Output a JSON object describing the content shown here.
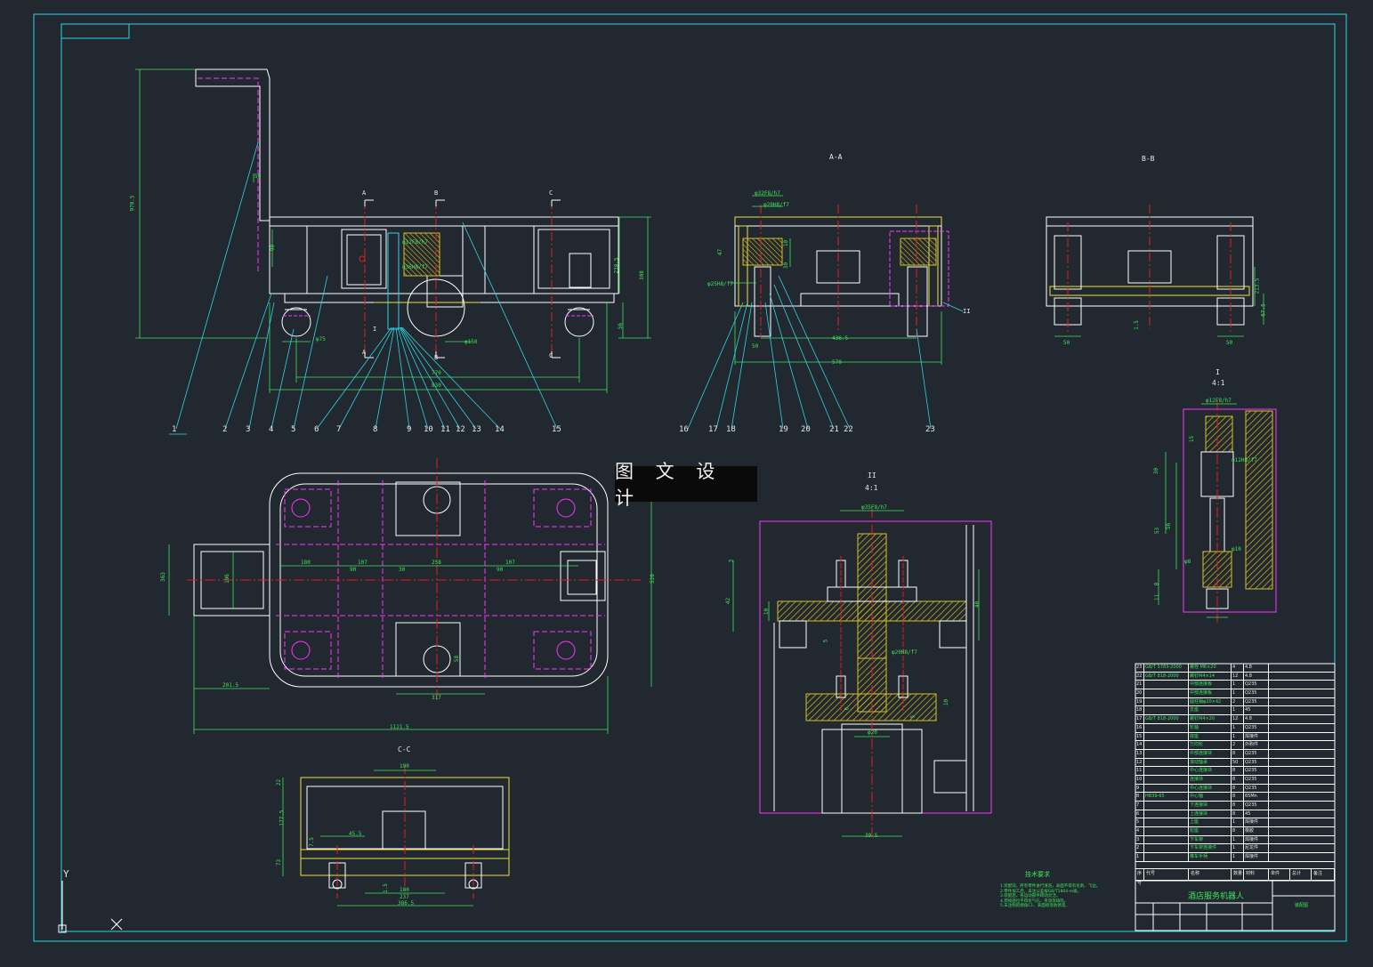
{
  "watermark": "图 文 设 计",
  "view_titles": {
    "section_aa": "A-A",
    "section_bb": "B-B",
    "section_cc": "C-C",
    "detail_i_label": "I",
    "detail_i_scale": "4:1",
    "detail_ii_label": "II",
    "detail_ii_scale": "4:1"
  },
  "section_markers": [
    "A",
    "B",
    "C",
    "A",
    "B",
    "C",
    "I",
    "II"
  ],
  "callouts": [
    "1",
    "2",
    "3",
    "4",
    "5",
    "6",
    "7",
    "8",
    "9",
    "10",
    "11",
    "12",
    "13",
    "14",
    "15",
    "16",
    "17",
    "18",
    "19",
    "20",
    "21",
    "22",
    "23"
  ],
  "dimensions": {
    "front": [
      "970.5",
      "50",
      "90",
      "238.5",
      "308",
      "56",
      "φ75",
      "φ12F8/h7",
      "φ36H8/f7",
      "φ150",
      "770",
      "830"
    ],
    "section_aa": [
      "φ32F8/h7",
      "φ20H8/f7",
      "47",
      "10",
      "φ25H8/f7",
      "30",
      "50",
      "436.5",
      "570"
    ],
    "section_bb": [
      "213.5",
      "67.5",
      "1.5",
      "50",
      "50"
    ],
    "plan": [
      "180",
      "107",
      "90",
      "30",
      "258",
      "107",
      "90",
      "363",
      "196",
      "520",
      "58",
      "317",
      "201.5",
      "1121.5"
    ],
    "section_cc": [
      "190",
      "22",
      "177.5",
      "45.5",
      "73",
      "7.5",
      "1.5",
      "180",
      "237",
      "386.5"
    ],
    "detail_ii": [
      "φ35F8/h7",
      "42",
      "3",
      "10",
      "5",
      "40",
      "φ20H8/f7",
      "5",
      "10",
      "6",
      "φ20",
      "39.5"
    ],
    "detail_i": [
      "φ12F8/h7",
      "15",
      "φ12H8/f7",
      "30",
      "53",
      "56",
      "φ8",
      "φ10",
      "8",
      "11"
    ]
  },
  "bom": {
    "rows": [
      {
        "no": "23",
        "code": "GB/T 5783-2000",
        "name": "螺栓 M6×20",
        "qty": "4",
        "mat": "4.8"
      },
      {
        "no": "22",
        "code": "GB/T 818-2000",
        "name": "螺钉M4×14",
        "qty": "12",
        "mat": "4.8"
      },
      {
        "no": "21",
        "code": "",
        "name": "中部连接板",
        "qty": "1",
        "mat": "Q235"
      },
      {
        "no": "20",
        "code": "",
        "name": "中部连接板",
        "qty": "1",
        "mat": "Q235"
      },
      {
        "no": "19",
        "code": "",
        "name": "圆柱销φ20×42",
        "qty": "2",
        "mat": "Q235"
      },
      {
        "no": "18",
        "code": "",
        "name": "支座",
        "qty": "1",
        "mat": "45"
      },
      {
        "no": "17",
        "code": "GB/T 818-2000",
        "name": "螺钉M4×20",
        "qty": "12",
        "mat": "4.8"
      },
      {
        "no": "16",
        "code": "",
        "name": "轮轴",
        "qty": "1",
        "mat": "Q235"
      },
      {
        "no": "15",
        "code": "",
        "name": "底座",
        "qty": "1",
        "mat": "焊接件"
      },
      {
        "no": "14",
        "code": "",
        "name": "万向轮",
        "qty": "2",
        "mat": "外购件"
      },
      {
        "no": "13",
        "code": "",
        "name": "中部连接块",
        "qty": "8",
        "mat": "Q235"
      },
      {
        "no": "12",
        "code": "",
        "name": "滚动轴承",
        "qty": "50",
        "mat": "Q235"
      },
      {
        "no": "11",
        "code": "",
        "name": "中心连接块",
        "qty": "8",
        "mat": "Q235"
      },
      {
        "no": "10",
        "code": "",
        "name": "连接块",
        "qty": "8",
        "mat": "Q235"
      },
      {
        "no": "9",
        "code": "",
        "name": "中心连接块",
        "qty": "8",
        "mat": "Q235"
      },
      {
        "no": "8",
        "code": "HB39-65",
        "name": "中心轴",
        "qty": "8",
        "mat": "65Mn"
      },
      {
        "no": "7",
        "code": "",
        "name": "下连接块",
        "qty": "8",
        "mat": "Q235"
      },
      {
        "no": "6",
        "code": "",
        "name": "上连接块",
        "qty": "8",
        "mat": "45"
      },
      {
        "no": "5",
        "code": "",
        "name": "上座",
        "qty": "1",
        "mat": "焊接件"
      },
      {
        "no": "4",
        "code": "",
        "name": "轮座",
        "qty": "8",
        "mat": "橡胶"
      },
      {
        "no": "3",
        "code": "",
        "name": "下车架",
        "qty": "1",
        "mat": "焊接件"
      },
      {
        "no": "2",
        "code": "",
        "name": "下车架连接件",
        "qty": "1",
        "mat": "尼龙件"
      },
      {
        "no": "1",
        "code": "",
        "name": "推车手柄",
        "qty": "1",
        "mat": "焊接件"
      }
    ],
    "header": [
      "序号",
      "代号",
      "名称",
      "数量",
      "材料",
      "单件",
      "总计",
      "备注"
    ]
  },
  "title_block": {
    "name": "酒店服务机器人",
    "code": "装配图"
  },
  "tech_requirements": {
    "title": "技术要求",
    "lines": [
      "1.装配前，所有零件进行清洗，表面不得有毛刺、飞边。",
      "2.零件加工后，未注公差按GB/T1804-m级。",
      "3.装配后，各运动部件转动灵活。",
      "4.焊接部位不得有气孔、夹渣等缺陷。",
      "5.未注明的倒角C1，表面喷涂防锈漆。"
    ]
  },
  "colors": {
    "background": "#212830",
    "frame": "#2fd3e3",
    "part_white": "#ffffff",
    "centerline_red": "#e02020",
    "hidden_magenta": "#ff33ff",
    "dimension_green": "#3fe35a",
    "highlight_yellow": "#f0e040",
    "hatch_yellow": "#d8c020"
  },
  "axis_icon": {
    "y_label": "Y",
    "x_label": "X"
  }
}
